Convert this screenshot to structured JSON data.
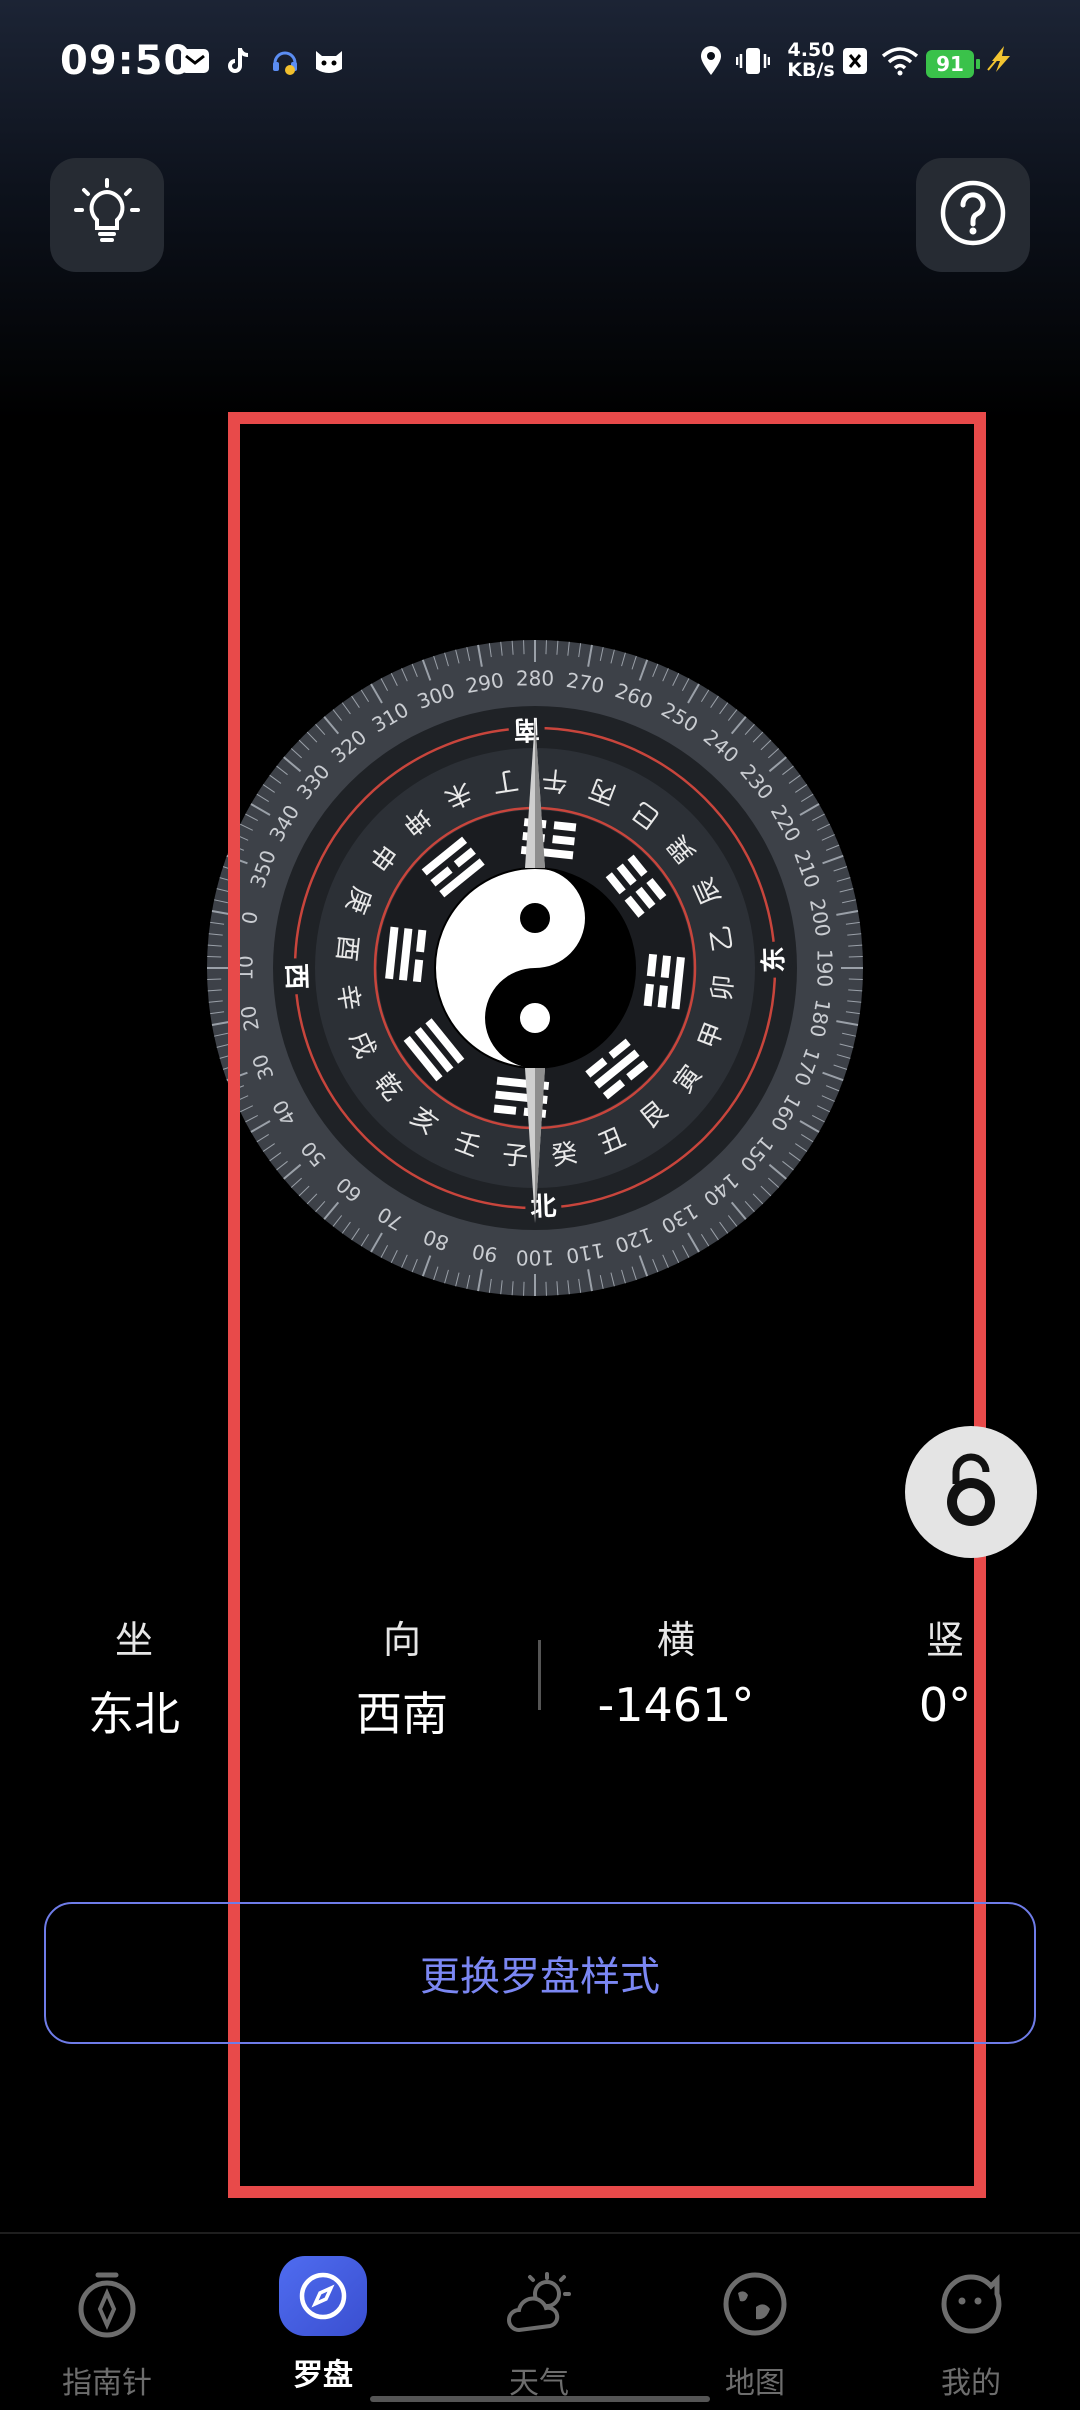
{
  "status_bar": {
    "time": "09:50",
    "net_speed_value": "4.50",
    "net_speed_unit": "KB/s",
    "battery": "91",
    "notification_icons": [
      "mail-icon",
      "tiktok-icon",
      "headset-icon",
      "cat-app-icon"
    ],
    "system_icons": [
      "location-icon",
      "vibrate-icon",
      "sim-off-icon",
      "wifi-icon",
      "battery-icon",
      "charging-icon"
    ]
  },
  "compass": {
    "degree_labels": [
      "0",
      "10",
      "20",
      "30",
      "40",
      "50",
      "60",
      "70",
      "80",
      "90",
      "100",
      "110",
      "120",
      "130",
      "140",
      "150",
      "160",
      "170",
      "180",
      "190",
      "200",
      "210",
      "220",
      "230",
      "240",
      "250",
      "260",
      "270",
      "280",
      "290",
      "300",
      "310",
      "320",
      "330",
      "340",
      "350"
    ],
    "mountains": [
      "子",
      "癸",
      "丑",
      "艮",
      "寅",
      "甲",
      "卯",
      "乙",
      "辰",
      "巽",
      "巳",
      "丙",
      "午",
      "丁",
      "未",
      "坤",
      "申",
      "庚",
      "酉",
      "辛",
      "戌",
      "乾",
      "亥",
      "壬"
    ],
    "cardinals": {
      "south": "南",
      "west": "西",
      "north": "北",
      "east": "东"
    }
  },
  "readings": [
    {
      "label": "坐",
      "value": "东北"
    },
    {
      "label": "向",
      "value": "西南"
    },
    {
      "label": "横",
      "value": "-1461°"
    },
    {
      "label": "竖",
      "value": "0°"
    }
  ],
  "change_style_button": "更换罗盘样式",
  "nav": [
    {
      "label": "指南针",
      "icon": "compass-needle-icon",
      "active": false
    },
    {
      "label": "罗盘",
      "icon": "compass-icon",
      "active": true
    },
    {
      "label": "天气",
      "icon": "weather-icon",
      "active": false
    },
    {
      "label": "地图",
      "icon": "map-icon",
      "active": false
    },
    {
      "label": "我的",
      "icon": "profile-icon",
      "active": false
    }
  ],
  "colors": {
    "accent": "#7b87f3",
    "highlight": "#e84a4a",
    "battery": "#3ac24a"
  }
}
